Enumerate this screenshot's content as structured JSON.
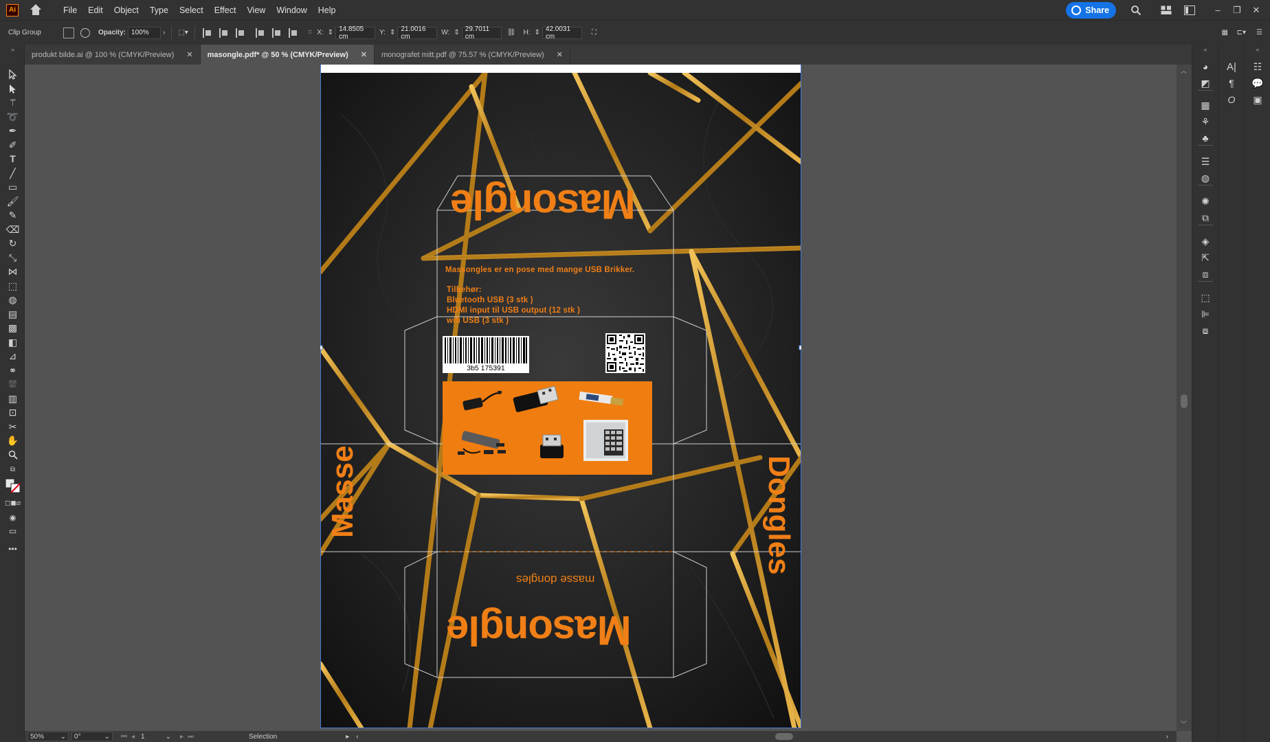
{
  "app": {
    "logo_text": "Ai"
  },
  "menu": [
    "File",
    "Edit",
    "Object",
    "Type",
    "Select",
    "Effect",
    "View",
    "Window",
    "Help"
  ],
  "share_label": "Share",
  "control": {
    "selection_type": "Clip Group",
    "opacity_label": "Opacity:",
    "opacity_value": "100%",
    "x_label": "X:",
    "x_value": "14.8505 cm",
    "y_label": "Y:",
    "y_value": "21.0016 cm",
    "w_label": "W:",
    "w_value": "29.7011 cm",
    "h_label": "H:",
    "h_value": "42.0031 cm"
  },
  "tabs": [
    {
      "label": "produkt bilde.ai @ 100 % (CMYK/Preview)",
      "active": false
    },
    {
      "label": "masongle.pdf* @ 50 % (CMYK/Preview)",
      "active": true
    },
    {
      "label": "monografet mitt.pdf @ 75.57 % (CMYK/Preview)",
      "active": false
    }
  ],
  "artwork": {
    "brand": "Masongle",
    "tagline": "masse dongles",
    "side_left": "Masse",
    "side_right": "Dongles",
    "description": "Massongles er en pose med mange USB Brikker.",
    "contents_heading": "Tilbehør:",
    "contents": [
      "Bluetooth USB  (3 stk )",
      "HDMI  input til USB output (12 stk )",
      "wifi USB (3 stk )"
    ],
    "barcode_number": "3b5 175391",
    "colors": {
      "accent": "#f07f16",
      "gold": "#c9952a",
      "background": "#1c1c1c"
    }
  },
  "status": {
    "zoom": "50%",
    "rotation": "0°",
    "artboard_number": "1",
    "tool": "Selection"
  }
}
